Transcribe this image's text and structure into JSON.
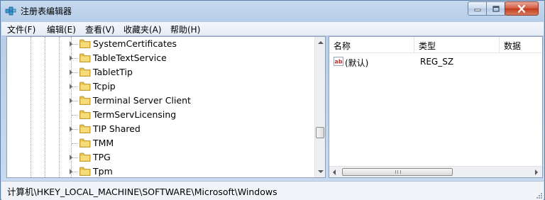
{
  "window": {
    "title": "注册表编辑器",
    "icon": "regedit-icon",
    "controls": [
      "minimize",
      "maximize",
      "close"
    ]
  },
  "menu": [
    {
      "label": "文件(F)"
    },
    {
      "label": "编辑(E)"
    },
    {
      "label": "查看(V)"
    },
    {
      "label": "收藏夹(A)"
    },
    {
      "label": "帮助(H)"
    }
  ],
  "tree": {
    "items": [
      {
        "label": "SystemCertificates",
        "expandable": true
      },
      {
        "label": "TableTextService",
        "expandable": true
      },
      {
        "label": "TabletTip",
        "expandable": true
      },
      {
        "label": "Tcpip",
        "expandable": true
      },
      {
        "label": "Terminal Server Client",
        "expandable": true
      },
      {
        "label": "TermServLicensing",
        "expandable": false
      },
      {
        "label": "TIP Shared",
        "expandable": true
      },
      {
        "label": "TMM",
        "expandable": false
      },
      {
        "label": "TPG",
        "expandable": true
      },
      {
        "label": "Tpm",
        "expandable": true
      }
    ]
  },
  "values": {
    "columns": [
      "名称",
      "类型",
      "数据"
    ],
    "rows": [
      {
        "name": "(默认)",
        "type": "REG_SZ",
        "data": "",
        "icon": "string-value-icon"
      }
    ]
  },
  "status": {
    "path": "计算机\\HKEY_LOCAL_MACHINE\\SOFTWARE\\Microsoft\\Windows"
  },
  "colors": {
    "folder": "#e8c24a",
    "titlebar": "#c5d9ee",
    "close_button": "#c33a1c"
  }
}
